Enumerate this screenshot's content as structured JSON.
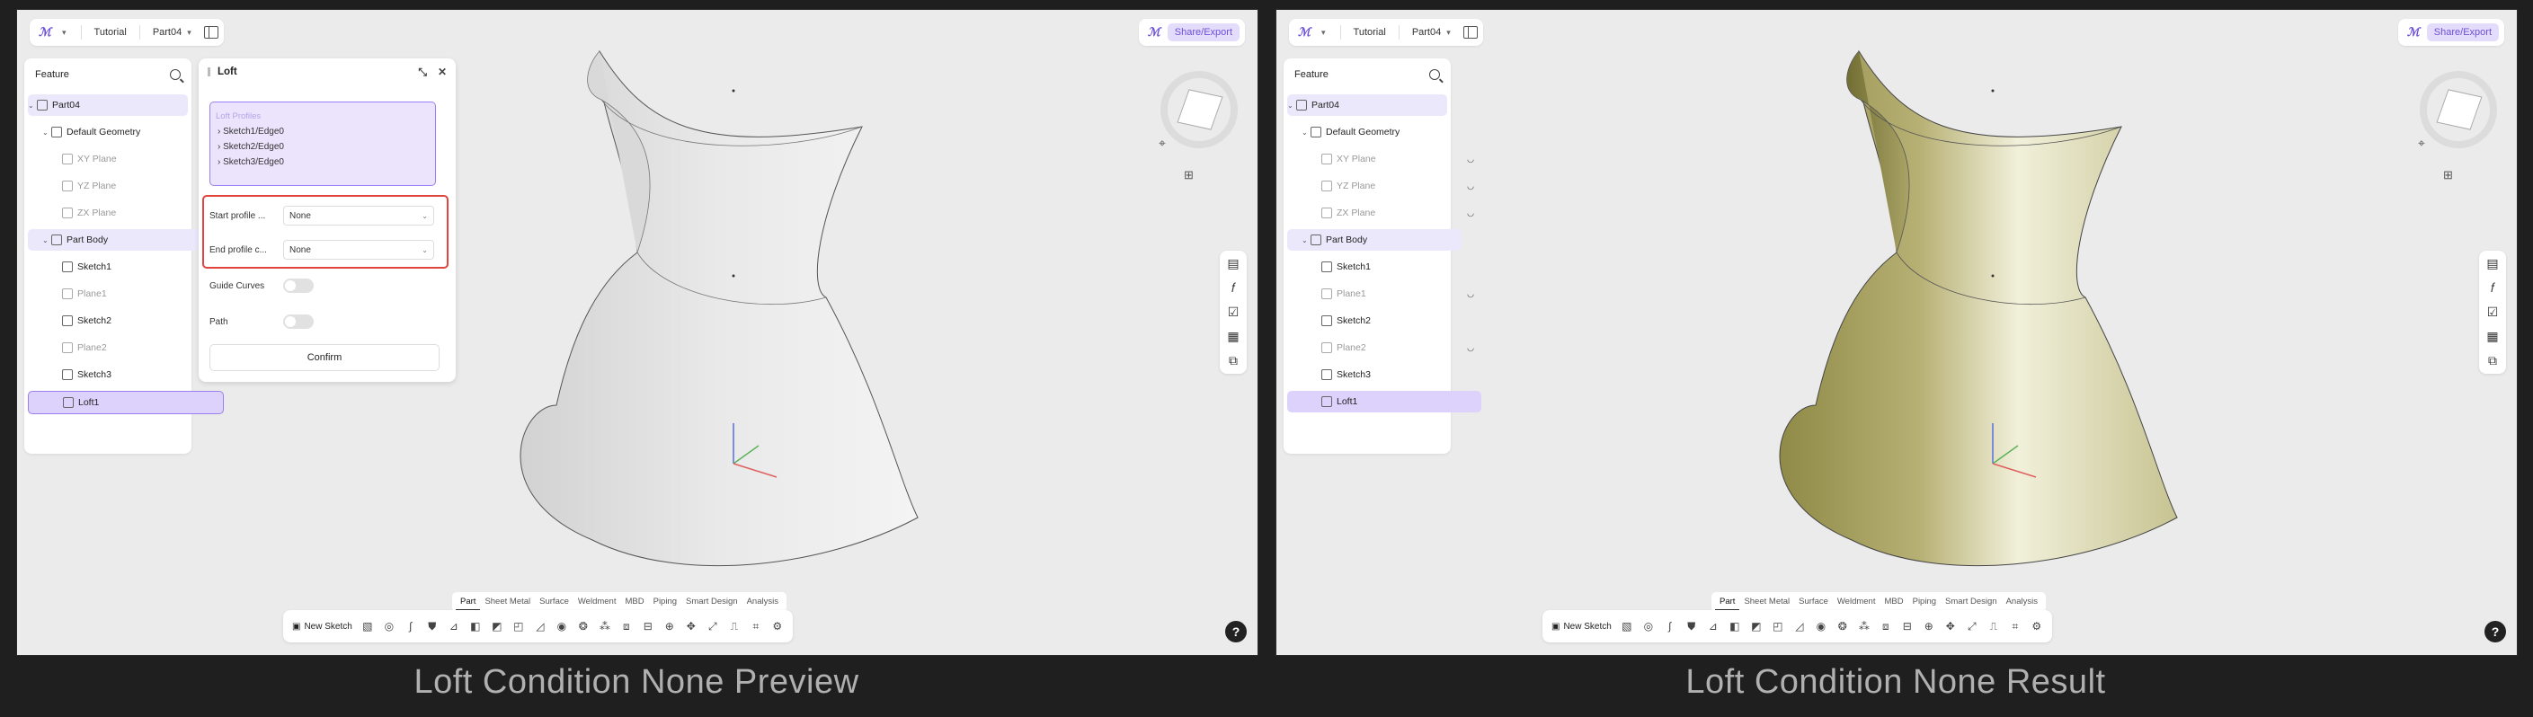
{
  "topbar": {
    "project": "Tutorial",
    "part": "Part04"
  },
  "share_label": "Share/Export",
  "tree": {
    "title": "Feature",
    "rows": [
      {
        "label": "Part04",
        "kind": "root"
      },
      {
        "label": "Default Geometry",
        "kind": "group"
      },
      {
        "label": "XY Plane",
        "kind": "plane"
      },
      {
        "label": "YZ Plane",
        "kind": "plane"
      },
      {
        "label": "ZX Plane",
        "kind": "plane"
      },
      {
        "label": "Part Body",
        "kind": "group"
      },
      {
        "label": "Sketch1",
        "kind": "sketch"
      },
      {
        "label": "Plane1",
        "kind": "plane"
      },
      {
        "label": "Sketch2",
        "kind": "sketch"
      },
      {
        "label": "Plane2",
        "kind": "plane"
      },
      {
        "label": "Sketch3",
        "kind": "sketch"
      },
      {
        "label": "Loft1",
        "kind": "feature"
      }
    ]
  },
  "loft": {
    "title": "Loft",
    "profiles_title": "Loft Profiles",
    "profiles": [
      "Sketch1/Edge0",
      "Sketch2/Edge0",
      "Sketch3/Edge0"
    ],
    "start_label": "Start profile ...",
    "start_value": "None",
    "end_label": "End profile c...",
    "end_value": "None",
    "guide_label": "Guide Curves",
    "path_label": "Path",
    "confirm_label": "Confirm"
  },
  "tabs": [
    "Part",
    "Sheet Metal",
    "Surface",
    "Weldment",
    "MBD",
    "Piping",
    "Smart Design",
    "Analysis"
  ],
  "new_sketch_label": "New Sketch",
  "captions": {
    "left": "Loft Condition None  Preview",
    "right": "Loft Condition None  Result"
  },
  "colors": {
    "accent": "#6b4fd8",
    "selection_border": "#9b7ff0",
    "highlight_box": "#e0463e",
    "preview_surface": "#e3e3e3",
    "result_surface": "#bdb67a"
  }
}
